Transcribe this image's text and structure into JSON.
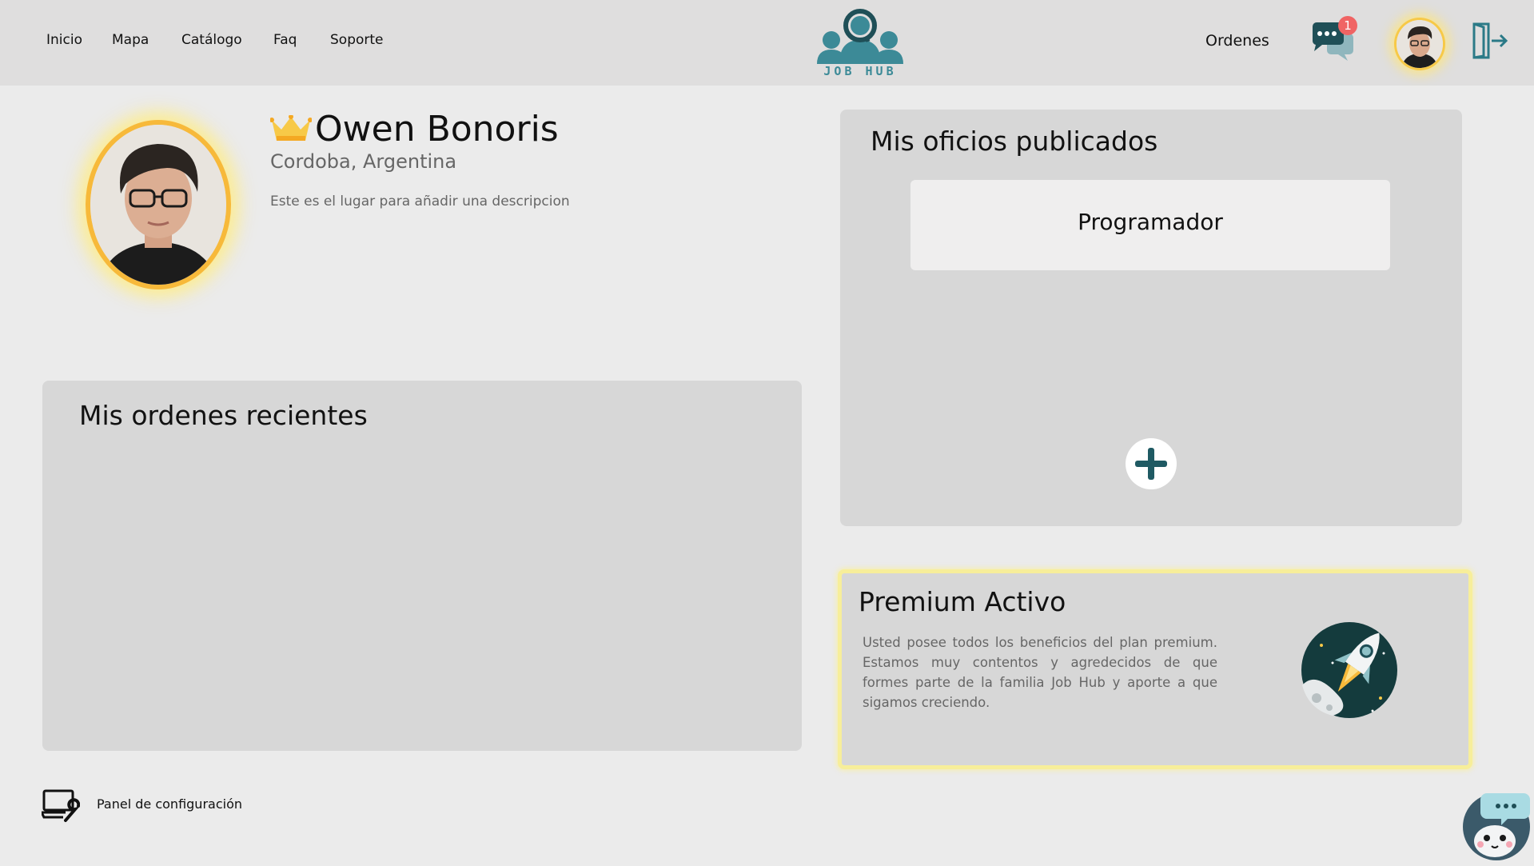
{
  "nav": {
    "items": [
      {
        "label": "Inicio"
      },
      {
        "label": "Mapa"
      },
      {
        "label": "Catálogo"
      },
      {
        "label": "Faq"
      },
      {
        "label": "Soporte"
      }
    ],
    "logo_text": "JOB HUB",
    "orders_label": "Ordenes",
    "messages_badge": "1",
    "icons": [
      "chat-icon",
      "avatar",
      "logout-icon"
    ]
  },
  "profile": {
    "name": "Owen Bonoris",
    "location": "Cordoba, Argentina",
    "description": "Este es el lugar para añadir una descripcion",
    "badge_icon": "crown-icon"
  },
  "orders_panel": {
    "title": "Mis ordenes recientes"
  },
  "jobs_panel": {
    "title": "Mis oficios publicados",
    "jobs": [
      {
        "label": "Programador"
      }
    ],
    "add_icon": "plus-icon"
  },
  "premium": {
    "title": "Premium Activo",
    "text": "Usted posee todos los beneficios del plan premium. Estamos muy contentos y agredecidos de que formes parte de la familia Job Hub y aporte a que sigamos creciendo.",
    "icon": "rocket-icon"
  },
  "footer": {
    "config_label": "Panel de configuración",
    "config_icon": "laptop-wrench-icon",
    "chatbot_icon": "chatbot-icon"
  },
  "colors": {
    "topbar": "#dfdede",
    "background": "#ebebeb",
    "panel": "#d7d7d7",
    "teal": "#3c8a97",
    "dark_teal": "#1f4f57",
    "gold": "#f7b93a",
    "premium_border": "#f7ee9a"
  }
}
